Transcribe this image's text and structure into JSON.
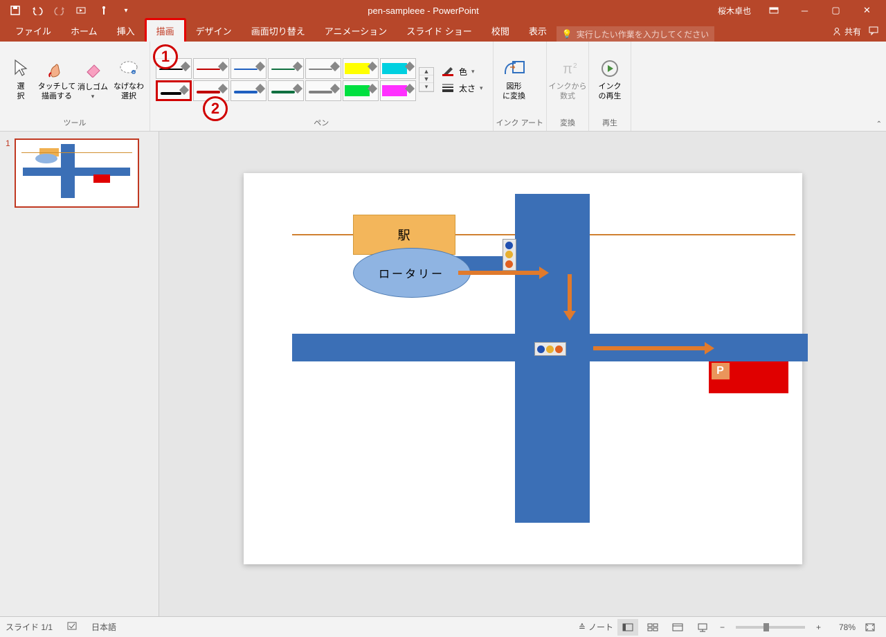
{
  "app": {
    "title": "pen-sampleee  -  PowerPoint",
    "user": "桜木卓也"
  },
  "qat": {
    "save": "save",
    "undo": "undo",
    "redo": "redo",
    "start": "start",
    "pointer": "pointer",
    "more": "more"
  },
  "tabs": [
    "ファイル",
    "ホーム",
    "挿入",
    "描画",
    "デザイン",
    "画面切り替え",
    "アニメーション",
    "スライド ショー",
    "校閲",
    "表示"
  ],
  "active_tab_index": 3,
  "tell_me": "実行したい作業を入力してください",
  "share": "共有",
  "ribbon": {
    "tools": {
      "label": "ツール",
      "select": "選\n択",
      "touch_draw": "タッチして\n描画する",
      "eraser": "消しゴム",
      "lasso": "なげなわ\n選択"
    },
    "pens": {
      "label": "ペン",
      "row1_colors": [
        "#000000",
        "#c00000",
        "#2060c0",
        "#107040",
        "#808080"
      ],
      "row1_hilite": [
        "#ffff00",
        "#00d0e0"
      ],
      "row2_colors": [
        "#000000",
        "#c00000",
        "#2060c0",
        "#107040",
        "#808080"
      ],
      "row2_hilite": [
        "#00e040",
        "#ff30ff"
      ],
      "color_label": "色",
      "thickness_label": "太さ"
    },
    "inkart": {
      "label": "インク アート",
      "shape_convert": "図形\nに変換"
    },
    "convert": {
      "label": "変換",
      "math": "インクから\n数式"
    },
    "replay": {
      "label": "再生",
      "ink_replay": "インク\nの再生"
    }
  },
  "callouts": {
    "one": "1",
    "two": "2"
  },
  "thumbs": {
    "first": "1"
  },
  "slide": {
    "station": "駅",
    "rotary": "ロータリー",
    "parking": "P"
  },
  "status": {
    "slide_no": "スライド 1/1",
    "lang": "日本語",
    "notes": "ノート",
    "zoom": "78%"
  }
}
